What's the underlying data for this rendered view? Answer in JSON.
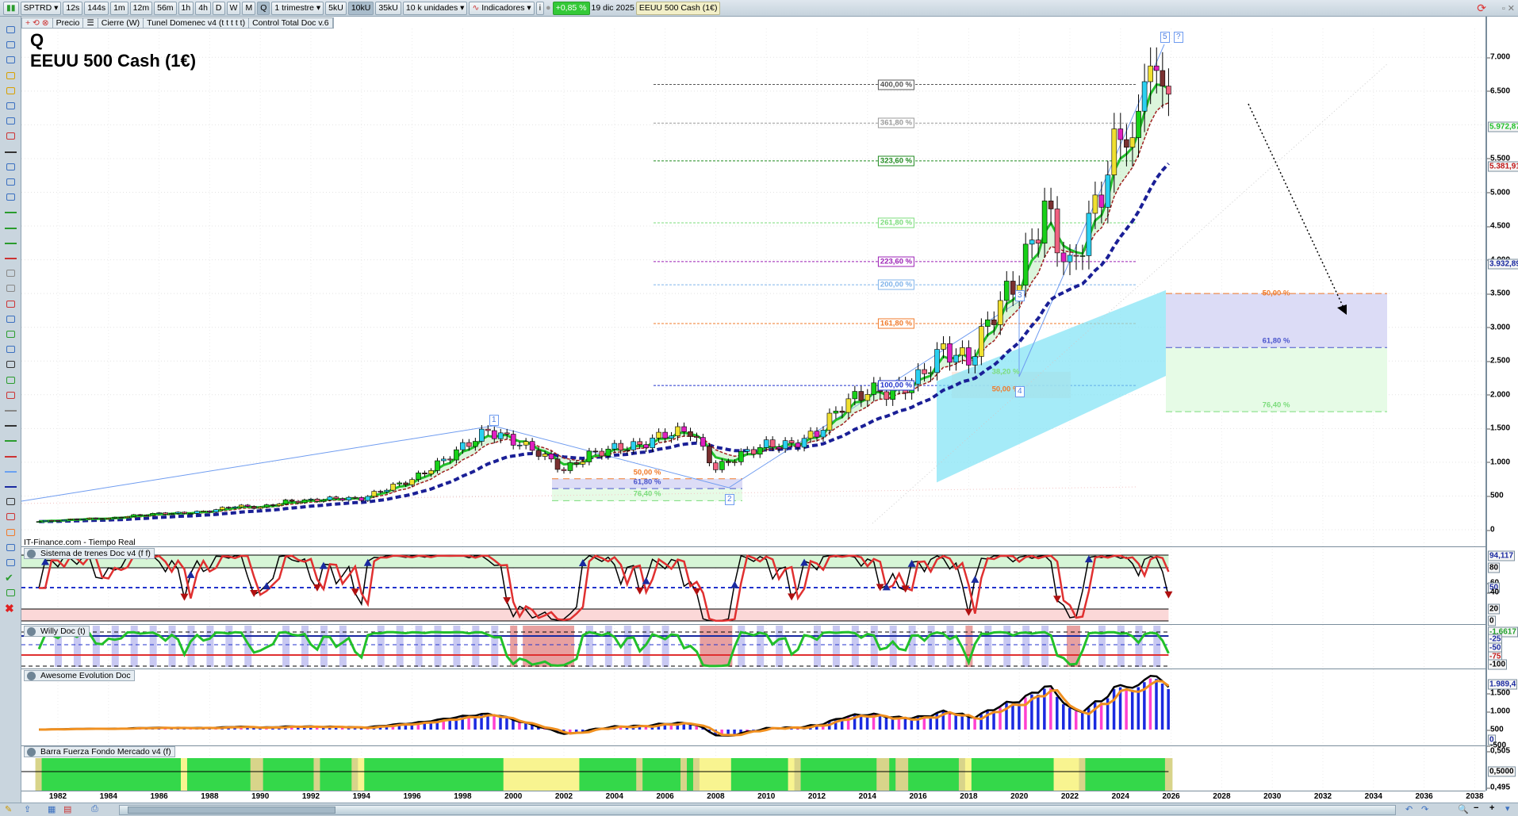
{
  "toolbar": {
    "symbol": "SPTRD",
    "timeframes": [
      "12s",
      "144s",
      "1m",
      "12m",
      "56m",
      "1h",
      "4h",
      "D",
      "W",
      "M",
      "Q"
    ],
    "period": "1 trimestre",
    "units": [
      "5kU",
      "10kU",
      "35kU"
    ],
    "units_select": "10 k unidades",
    "indicators": "Indicadores",
    "change": "+0,85 %",
    "date": "19 dic 2025",
    "instrument": "EEUU 500 Cash (1€)"
  },
  "legend": {
    "items": [
      "Precio",
      "Cierre (W)",
      "Tunel Domenec v4 (t t t t t)",
      "Control Total Doc v.6"
    ]
  },
  "title": {
    "period_letter": "Q",
    "name": "EEUU 500 Cash (1€)"
  },
  "source": "IT-Finance.com - Tiempo Real",
  "panels": {
    "trenes": "Sistema de trenes Doc v4 (f f)",
    "willy": "Willy Doc (t)",
    "awesome": "Awesome Evolution Doc",
    "barra": "Barra Fuerza Fondo Mercado v4 (f)"
  },
  "axes": {
    "main": [
      "7.000",
      "6.500",
      "5.500",
      "5.000",
      "4.500",
      "4.000",
      "3.500",
      "3.000",
      "2.500",
      "2.000",
      "1.500",
      "1.000",
      "500",
      "0"
    ],
    "main_boxes": [
      {
        "label": "5.972,87",
        "color": "#22c02a",
        "v": 5972
      },
      {
        "label": "5.381,91",
        "color": "#c01818",
        "v": 5381
      },
      {
        "label": "3.932,89",
        "color": "#1a2aa0",
        "v": 3932
      }
    ],
    "trenes": [
      "94,117",
      "80",
      "60",
      "50",
      "40",
      "20",
      "0"
    ],
    "willy": [
      "-1,6617",
      "-25",
      "-50",
      "-75",
      "-100"
    ],
    "awesome": [
      "1.989,4",
      "1.500",
      "1.000",
      "500",
      "0",
      "-500"
    ],
    "barra": [
      "0,505",
      "0,5000",
      "0,495"
    ]
  },
  "years": [
    "1982",
    "1984",
    "1986",
    "1988",
    "1990",
    "1992",
    "1994",
    "1996",
    "1998",
    "2000",
    "2002",
    "2004",
    "2006",
    "2008",
    "2010",
    "2012",
    "2014",
    "2016",
    "2018",
    "2020",
    "2022",
    "2024",
    "2026",
    "2028",
    "2030",
    "2032",
    "2034",
    "2036",
    "2038"
  ],
  "fib_upper": [
    {
      "label": "400,00 %",
      "v": 6598,
      "color": "#555555"
    },
    {
      "label": "361,80 %",
      "v": 6025,
      "color": "#999999"
    },
    {
      "label": "323,60 %",
      "v": 5465,
      "color": "#1f8a1f"
    },
    {
      "label": "261,80 %",
      "v": 4547,
      "color": "#7bdc7b"
    },
    {
      "label": "223,60 %",
      "v": 3973,
      "color": "#9b1fb5"
    },
    {
      "label": "200,00 %",
      "v": 3629,
      "color": "#7fb3ea"
    },
    {
      "label": "161,80 %",
      "v": 3055,
      "color": "#f07a2a"
    },
    {
      "label": "100,00 %",
      "v": 2137,
      "color": "#2233cc"
    }
  ],
  "fib_lower": [
    {
      "label": "50,00 %",
      "v": 755,
      "color": "#f07a2a"
    },
    {
      "label": "61,80 %",
      "v": 610,
      "color": "#4a55cc"
    },
    {
      "label": "76,40 %",
      "v": 430,
      "color": "#7bdc7b"
    }
  ],
  "fib_mid": [
    {
      "label": "38,20 %",
      "v": 2340,
      "color": "#7bdc7b"
    },
    {
      "label": "50,00 %",
      "v": 2080,
      "color": "#f07a2a"
    }
  ],
  "fib_projection": [
    {
      "label": "50,00 %",
      "v": 3500,
      "color": "#f07a2a"
    },
    {
      "label": "61,80 %",
      "v": 2700,
      "color": "#4a55cc"
    },
    {
      "label": "76,40 %",
      "v": 1750,
      "color": "#7bdc7b"
    }
  ],
  "waves": [
    "1",
    "2",
    "3",
    "4",
    "5",
    "?"
  ],
  "chart_data": {
    "type": "candlestick",
    "title": "EEUU 500 Cash (1€)",
    "xlabel": "",
    "ylabel": "",
    "ylim": [
      0,
      7000
    ],
    "xlim": [
      1981,
      2038
    ],
    "years": [
      1981,
      1982,
      1983,
      1984,
      1985,
      1986,
      1987,
      1988,
      1989,
      1990,
      1991,
      1992,
      1993,
      1994,
      1995,
      1996,
      1997,
      1998,
      1999,
      2000,
      2001,
      2002,
      2003,
      2004,
      2005,
      2006,
      2007,
      2008,
      2009,
      2010,
      2011,
      2012,
      2013,
      2014,
      2015,
      2016,
      2017,
      2018,
      2019,
      2020,
      2021,
      2022,
      2023,
      2024,
      2025.9
    ],
    "close": [
      122,
      140,
      164,
      167,
      211,
      242,
      247,
      277,
      353,
      330,
      417,
      435,
      466,
      459,
      615,
      740,
      970,
      1229,
      1469,
      1320,
      1148,
      880,
      1112,
      1212,
      1248,
      1418,
      1468,
      903,
      1115,
      1258,
      1258,
      1426,
      1848,
      2059,
      2044,
      2239,
      2674,
      2507,
      3231,
      3756,
      4766,
      3840,
      4770,
      5882,
      6850
    ]
  }
}
